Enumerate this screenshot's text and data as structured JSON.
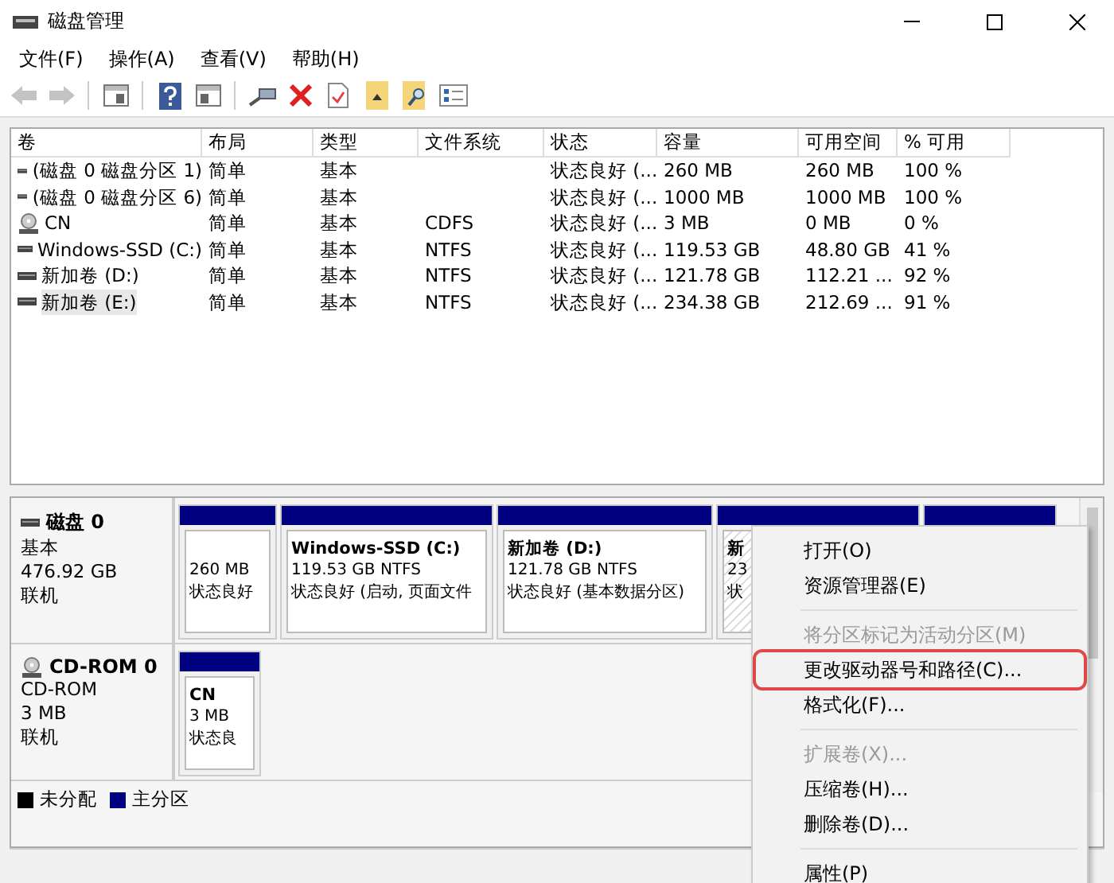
{
  "window": {
    "title": "磁盘管理"
  },
  "menu": [
    "文件(F)",
    "操作(A)",
    "查看(V)",
    "帮助(H)"
  ],
  "toolbar": [
    {
      "kind": "back",
      "disabled": true
    },
    {
      "kind": "forward",
      "disabled": true
    },
    {
      "kind": "sep"
    },
    {
      "kind": "panel"
    },
    {
      "kind": "sep"
    },
    {
      "kind": "help"
    },
    {
      "kind": "panel2"
    },
    {
      "kind": "sep"
    },
    {
      "kind": "connect"
    },
    {
      "kind": "delete"
    },
    {
      "kind": "check"
    },
    {
      "kind": "folder-up"
    },
    {
      "kind": "folder-search"
    },
    {
      "kind": "list"
    }
  ],
  "table": {
    "columns": [
      "卷",
      "布局",
      "类型",
      "文件系统",
      "状态",
      "容量",
      "可用空间",
      "% 可用"
    ],
    "rows": [
      {
        "kind": "disk",
        "selected": false,
        "cells": [
          "(磁盘 0 磁盘分区 1)",
          "简单",
          "基本",
          "",
          "状态良好 (...",
          "260 MB",
          "260 MB",
          "100 %"
        ]
      },
      {
        "kind": "disk",
        "selected": false,
        "cells": [
          "(磁盘 0 磁盘分区 6)",
          "简单",
          "基本",
          "",
          "状态良好 (...",
          "1000 MB",
          "1000 MB",
          "100 %"
        ]
      },
      {
        "kind": "cd",
        "selected": false,
        "cells": [
          "CN",
          "简单",
          "基本",
          "CDFS",
          "状态良好 (...",
          "3 MB",
          "0 MB",
          "0 %"
        ]
      },
      {
        "kind": "disk",
        "selected": false,
        "cells": [
          "Windows-SSD (C:)",
          "简单",
          "基本",
          "NTFS",
          "状态良好 (...",
          "119.53 GB",
          "48.80 GB",
          "41 %"
        ]
      },
      {
        "kind": "disk",
        "selected": false,
        "cells": [
          "新加卷 (D:)",
          "简单",
          "基本",
          "NTFS",
          "状态良好 (...",
          "121.78 GB",
          "112.21 ...",
          "92 %"
        ]
      },
      {
        "kind": "disk",
        "selected": true,
        "cells": [
          "新加卷 (E:)",
          "简单",
          "基本",
          "NTFS",
          "状态良好 (...",
          "234.38 GB",
          "212.69 ...",
          "91 %"
        ]
      }
    ]
  },
  "disks": [
    {
      "kind": "disk",
      "name": "磁盘 0",
      "type": "基本",
      "size": "476.92 GB",
      "status": "联机",
      "partitions": [
        {
          "kind": "primary",
          "size": "260 MB",
          "status": "状态良好",
          "selected": false
        },
        {
          "kind": "primary",
          "name": "Windows-SSD  (C:)",
          "size": "119.53 GB NTFS",
          "status": "状态良好 (启动, 页面文件",
          "selected": false
        },
        {
          "kind": "primary",
          "name": "新加卷  (D:)",
          "size": "121.78 GB NTFS",
          "status": "状态良好 (基本数据分区)",
          "selected": false
        },
        {
          "kind": "primary",
          "name": "新",
          "size": "23",
          "status": "状",
          "selected": true
        },
        {
          "kind": "primary"
        }
      ]
    },
    {
      "kind": "cd",
      "name": "CD-ROM 0",
      "type": "CD-ROM",
      "size": "3 MB",
      "status": "联机",
      "partitions": [
        {
          "kind": "primary",
          "name": "CN",
          "size": "3 MB",
          "status": "状态良",
          "selected": false
        }
      ]
    }
  ],
  "legend": [
    {
      "label": "未分配",
      "color": "#000000"
    },
    {
      "label": "主分区",
      "color": "#000080"
    }
  ],
  "context_menu": [
    {
      "kind": "item",
      "label": "打开(O)",
      "disabled": false,
      "highlighted": false
    },
    {
      "kind": "item",
      "label": "资源管理器(E)",
      "disabled": false,
      "highlighted": false
    },
    {
      "kind": "separator"
    },
    {
      "kind": "item",
      "label": "将分区标记为活动分区(M)",
      "disabled": true,
      "highlighted": false
    },
    {
      "kind": "item",
      "label": "更改驱动器号和路径(C)...",
      "disabled": false,
      "highlighted": true
    },
    {
      "kind": "item",
      "label": "格式化(F)...",
      "disabled": false,
      "highlighted": false
    },
    {
      "kind": "separator"
    },
    {
      "kind": "item",
      "label": "扩展卷(X)...",
      "disabled": true,
      "highlighted": false
    },
    {
      "kind": "item",
      "label": "压缩卷(H)...",
      "disabled": false,
      "highlighted": false
    },
    {
      "kind": "item",
      "label": "删除卷(D)...",
      "disabled": false,
      "highlighted": false
    },
    {
      "kind": "separator"
    },
    {
      "kind": "item",
      "label": "属性(P)",
      "disabled": false,
      "highlighted": false
    }
  ]
}
